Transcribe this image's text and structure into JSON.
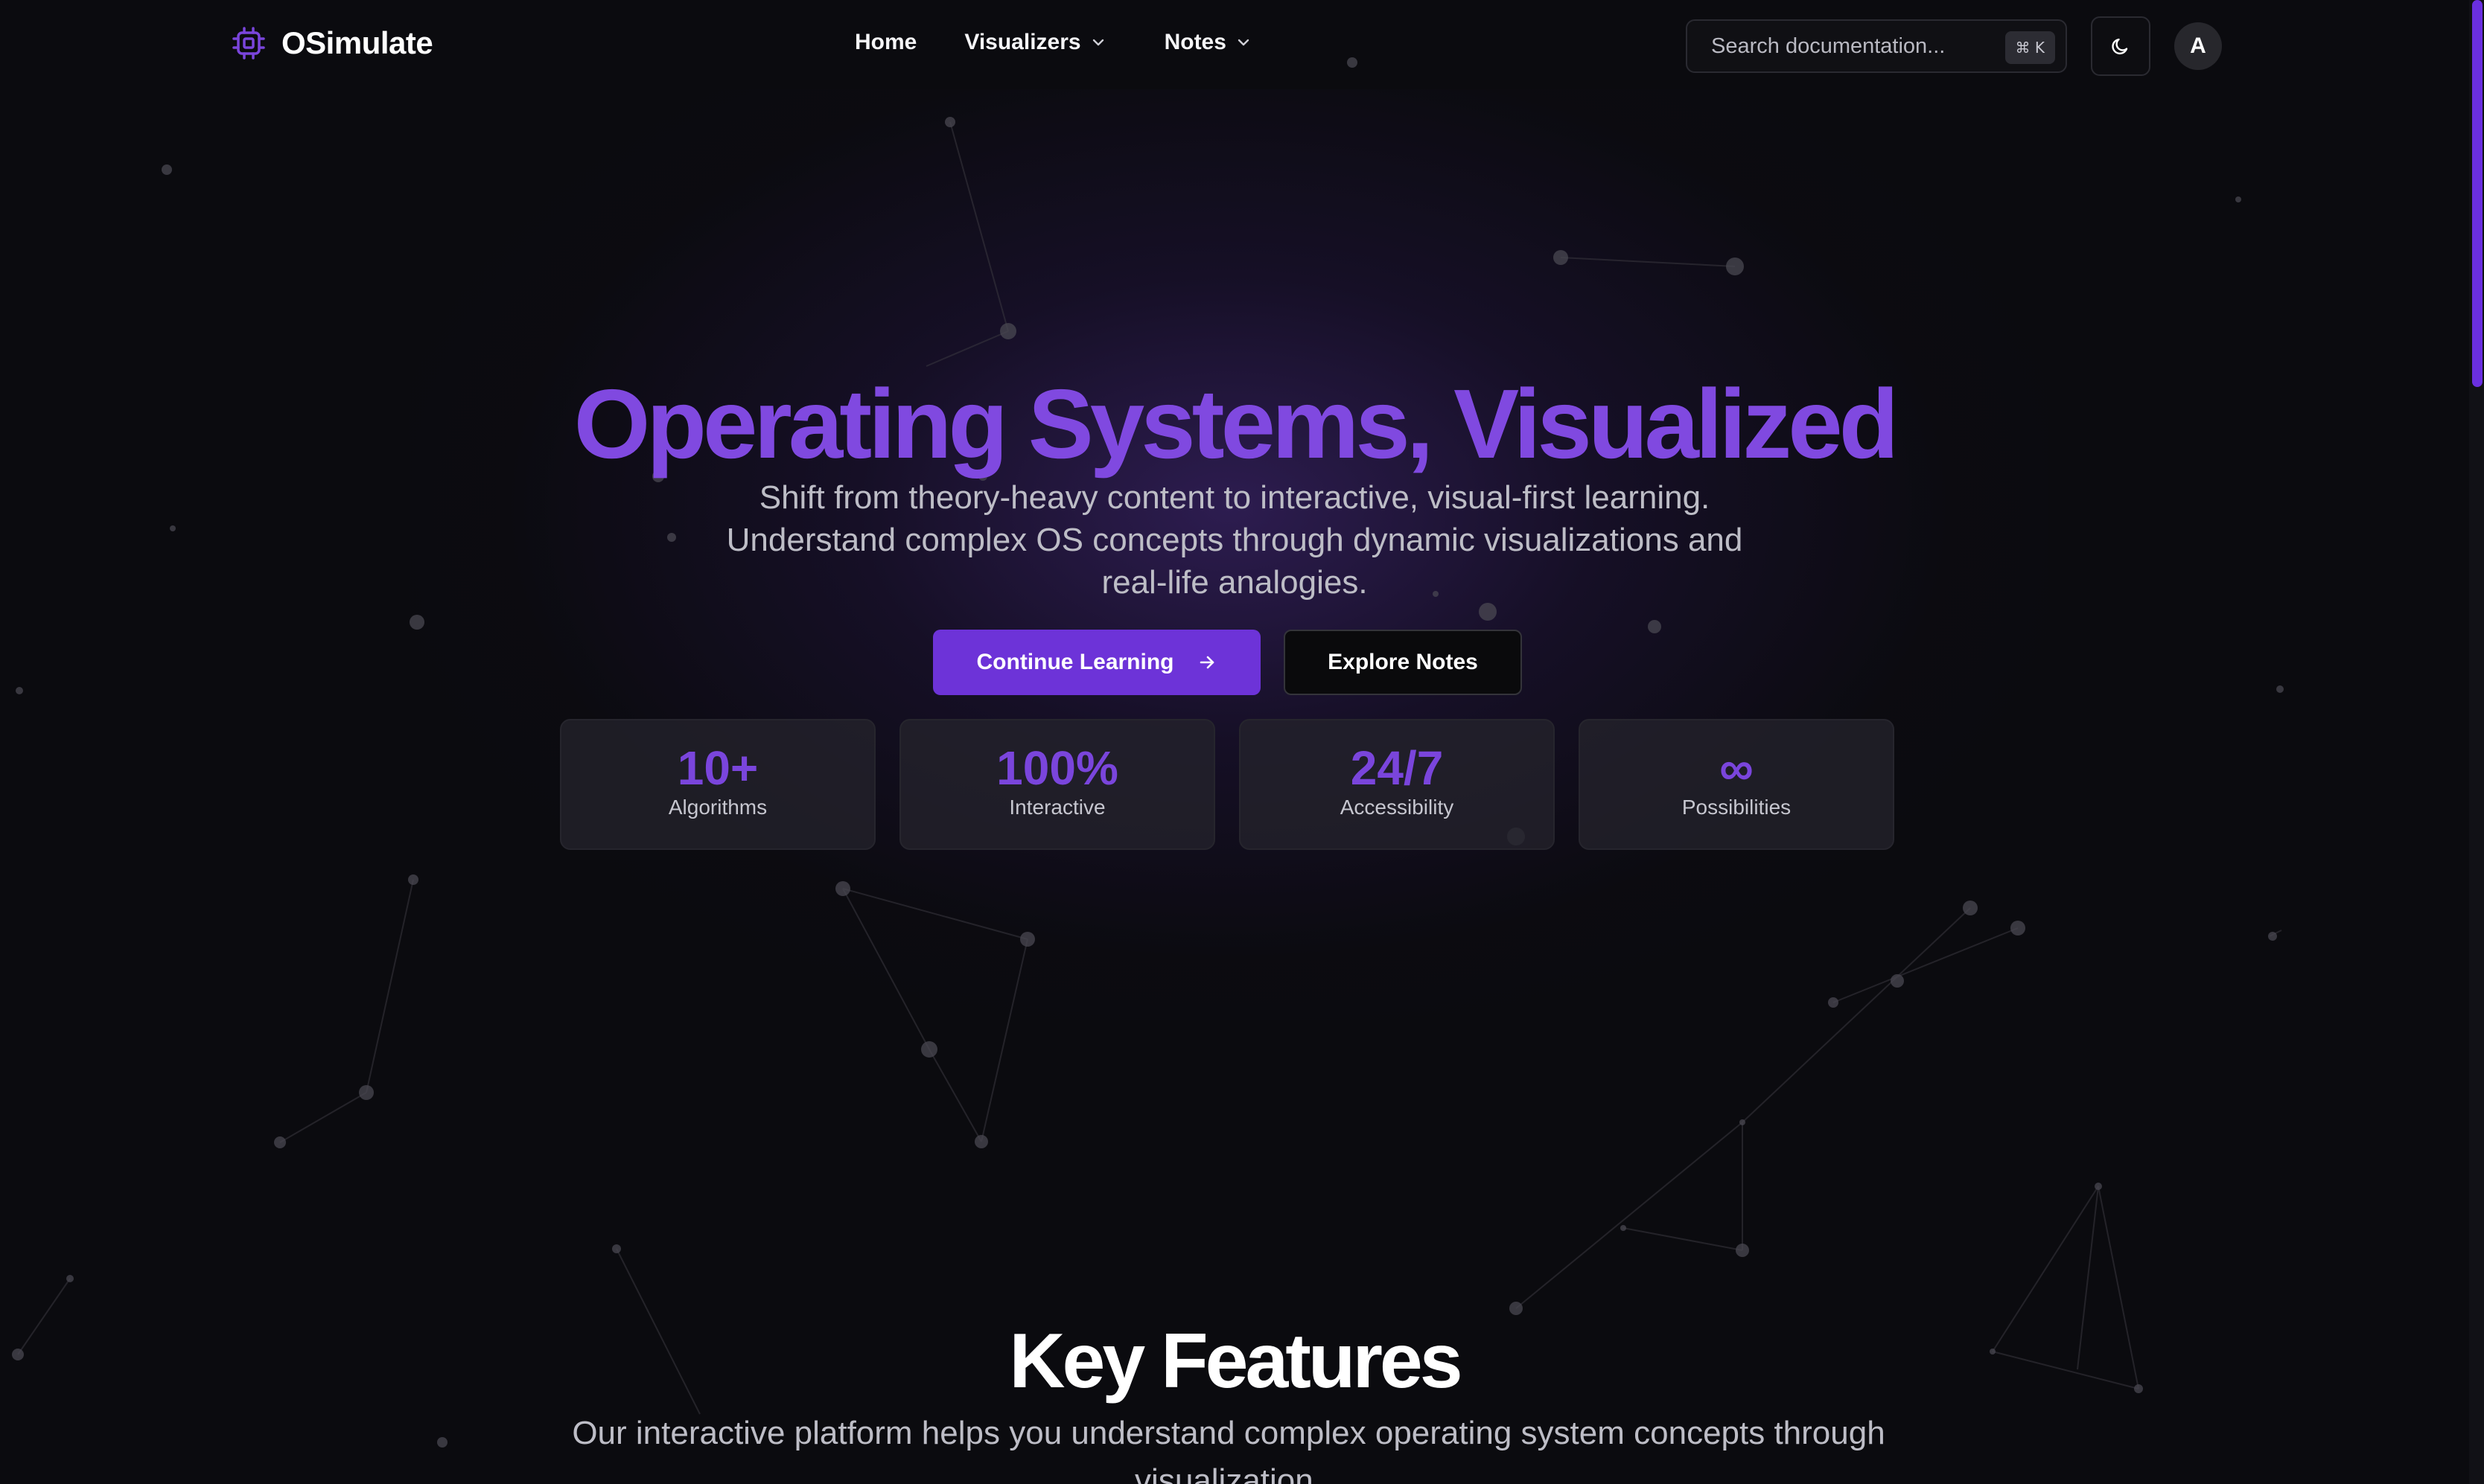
{
  "brand": {
    "name": "OSimulate",
    "icon": "cpu-chip-icon",
    "accent": "#7a45dc"
  },
  "nav": {
    "home": "Home",
    "visualizers": "Visualizers",
    "notes": "Notes"
  },
  "search": {
    "placeholder": "Search documentation...",
    "shortcut": "⌘ K"
  },
  "theme_toggle": {
    "icon": "moon-icon"
  },
  "user": {
    "avatar_initial": "A"
  },
  "hero": {
    "title": "Operating Systems, Visualized",
    "subtitle_lines": [
      "Shift from theory-heavy content to interactive, visual-first learning.",
      "Understand complex OS concepts through dynamic visualizations and",
      "real-life analogies."
    ],
    "primary_button": "Continue Learning",
    "secondary_button": "Explore Notes"
  },
  "stats": [
    {
      "value": "10+",
      "label": "Algorithms"
    },
    {
      "value": "100%",
      "label": "Interactive"
    },
    {
      "value": "24/7",
      "label": "Accessibility"
    },
    {
      "value": "∞",
      "label": "Possibilities"
    }
  ],
  "features": {
    "title": "Key Features",
    "subtitle": "Our interactive platform helps you understand complex operating system concepts through visualization."
  }
}
